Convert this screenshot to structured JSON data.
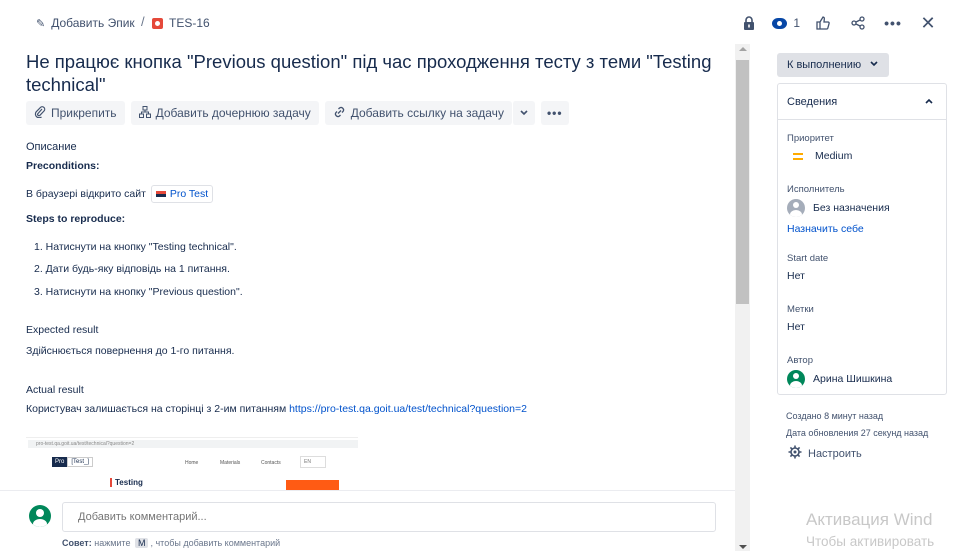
{
  "breadcrumb": {
    "epic_label": "Добавить Эпик",
    "separator": "/",
    "issue_key": "TES-16"
  },
  "top_actions": {
    "watch_count": "1",
    "icons": [
      "lock-icon",
      "eye-icon",
      "thumbs-up-icon",
      "share-icon",
      "more-icon",
      "close-icon"
    ]
  },
  "issue": {
    "title": "Не працює кнопка \"Previous question\" під час проходження тесту з теми \"Testing technical\""
  },
  "action_buttons": {
    "attach": "Прикрепить",
    "child_task": "Добавить дочернюю задачу",
    "link_task": "Добавить ссылку на задачу",
    "more": "•••"
  },
  "description": {
    "label": "Описание",
    "preconditions_heading": "Preconditions:",
    "precondition_text": "В браузері відкрито сайт",
    "site_chip": "Pro Test",
    "steps_heading": "Steps to reproduce:",
    "steps": [
      "1. Натиснути на кнопку \"Testing technical\".",
      "2. Дати будь-яку відповідь на 1 питання.",
      "3. Натиснути на кнопку \"Previous question\"."
    ],
    "expected_heading": "Expected result",
    "expected_text": "Здійснюється повернення до 1-го питання.",
    "actual_heading": "Actual result",
    "actual_text": "Користувач залишається на сторінці з 2-им питанням",
    "actual_link": "https://pro-test.qa.goit.ua/test/technical?question=2"
  },
  "screenshot_thumb": {
    "url_text": "pro-test.qa.goit.ua/test/technical?question=2",
    "logo_a": "Pro",
    "logo_b": "[Test_]",
    "nav": [
      "Home",
      "Materials",
      "Contacts"
    ],
    "lang": "EN",
    "heading": "Testing"
  },
  "comment": {
    "placeholder": "Добавить комментарий...",
    "tip_prefix": "Совет:",
    "tip_mid": "нажмите",
    "tip_key": "M",
    "tip_suffix": ", чтобы добавить комментарий"
  },
  "sidebar": {
    "status_label": "К выполнению",
    "details_title": "Сведения",
    "priority_label": "Приоритет",
    "priority_value": "Medium",
    "assignee_label": "Исполнитель",
    "assignee_value": "Без назначения",
    "assign_to_me": "Назначить себе",
    "start_date_label": "Start date",
    "start_date_value": "Нет",
    "labels_label": "Метки",
    "labels_value": "Нет",
    "reporter_label": "Автор",
    "reporter_value": "Арина Шишкина",
    "created": "Создано 8 минут назад",
    "updated": "Дата обновления 27 секунд назад",
    "configure": "Настроить"
  },
  "watermark": {
    "line1": "Активация Wind",
    "line2": "Чтобы активировать"
  },
  "colors": {
    "accent": "#0052cc",
    "bug": "#e5493a",
    "avatar_green": "#00875a",
    "priority_medium": "#ffab00"
  }
}
